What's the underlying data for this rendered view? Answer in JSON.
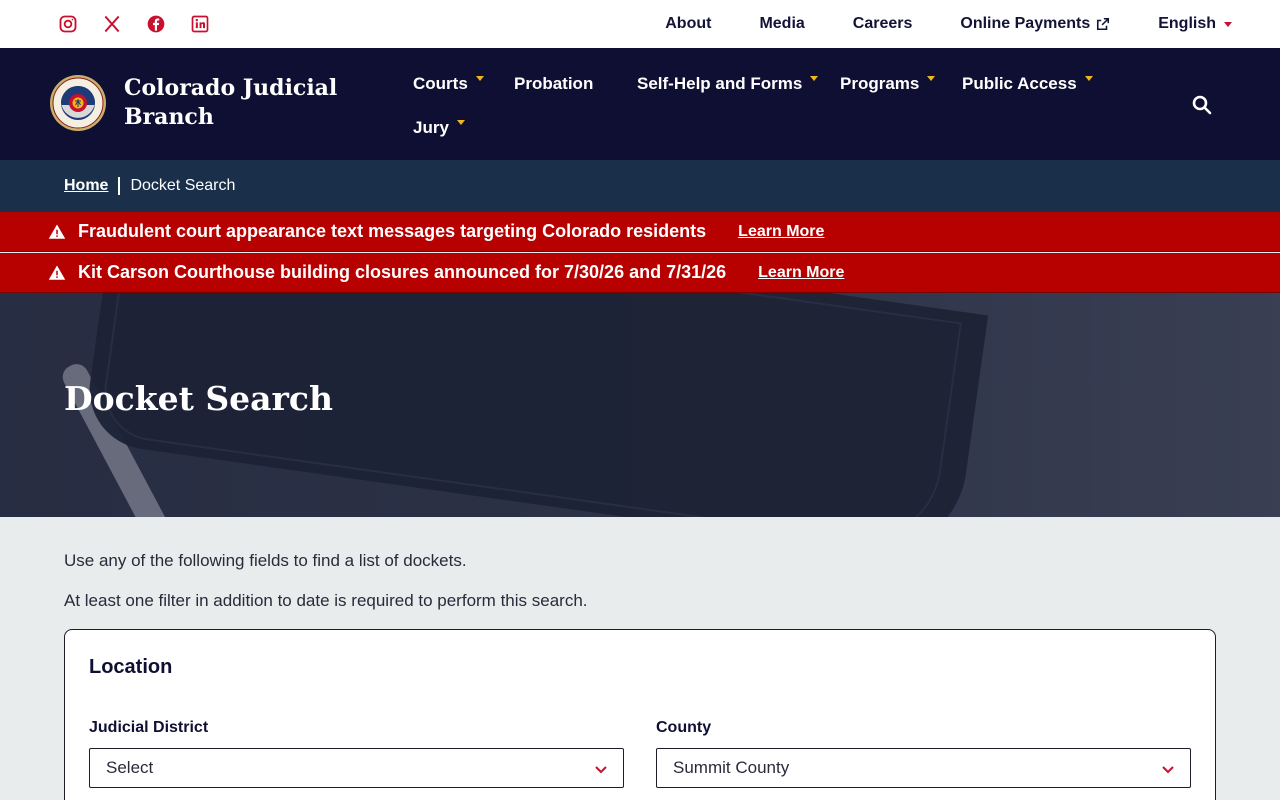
{
  "social": {
    "icons": [
      "instagram-icon",
      "x-icon",
      "facebook-icon",
      "linkedin-icon"
    ],
    "color": "#c8102e"
  },
  "utility_nav": {
    "about": "About",
    "media": "Media",
    "careers": "Careers",
    "online_payments": "Online Payments",
    "language": "English"
  },
  "brand": {
    "name": "Colorado Judicial Branch",
    "logo_icon": "colorado-courts-seal"
  },
  "main_nav": {
    "courts": "Courts",
    "probation": "Probation",
    "self_help": "Self-Help and Forms",
    "programs": "Programs",
    "public_access": "Public Access",
    "jury": "Jury",
    "accent": "#f2b51a"
  },
  "breadcrumb": {
    "home": "Home",
    "current": "Docket Search"
  },
  "alerts": [
    {
      "message": "Fraudulent court appearance text messages targeting Colorado residents",
      "link": "Learn More"
    },
    {
      "message": "Kit Carson Courthouse building closures announced for 7/30/26 and 7/31/26",
      "link": "Learn More"
    }
  ],
  "hero": {
    "title": "Docket Search"
  },
  "intro": {
    "line1": "Use any of the following fields to find a list of dockets.",
    "line2": "At least one filter in addition to date is required to perform this search."
  },
  "location": {
    "heading": "Location",
    "district_label": "Judicial District",
    "district_value": "Select",
    "county_label": "County",
    "county_value": "Summit County"
  },
  "colors": {
    "header_bg": "#0f0f33",
    "breadcrumb_bg": "#1a2f4a",
    "alert_bg": "#b70000",
    "page_bg": "#e9eced"
  }
}
